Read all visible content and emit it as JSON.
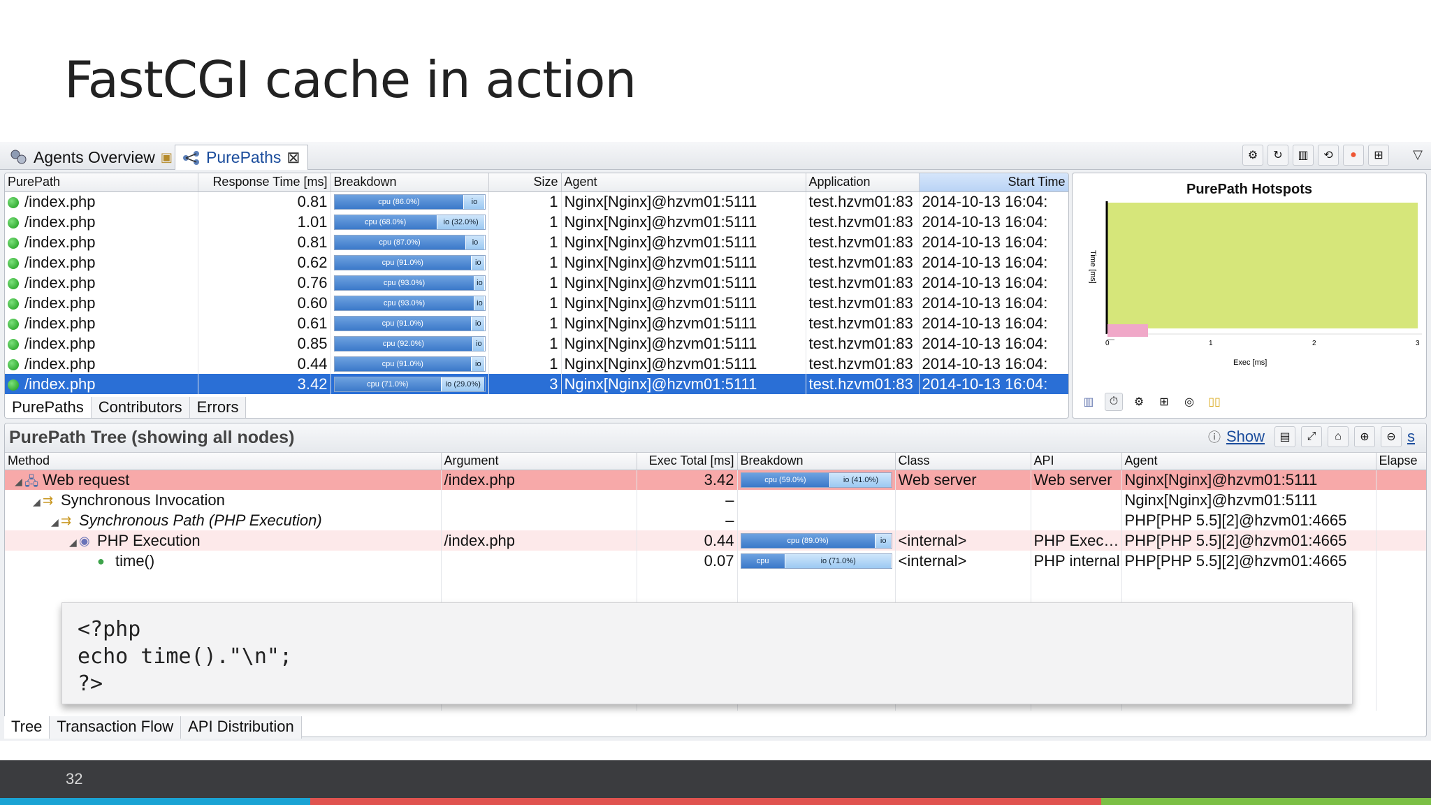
{
  "slide": {
    "title": "FastCGI cache in action",
    "page_number": "32"
  },
  "tabs": [
    {
      "label": "Agents Overview",
      "icon": "agents-icon"
    },
    {
      "label": "PurePaths",
      "icon": "purepaths-icon",
      "close": "⊠"
    }
  ],
  "purepaths": {
    "columns": [
      "PurePath",
      "Response Time [ms]",
      "Breakdown",
      "Size",
      "Agent",
      "Application",
      "Start Time"
    ],
    "rows": [
      {
        "path": "/index.php",
        "rt": "0.81",
        "cpu": "cpu (86.0%)",
        "io": "io",
        "cpu_pct": 86,
        "size": "1",
        "agent": "Nginx[Nginx]@hzvm01:5111",
        "app": "test.hzvm01:83",
        "start": "2014-10-13 16:04:"
      },
      {
        "path": "/index.php",
        "rt": "1.01",
        "cpu": "cpu (68.0%)",
        "io": "io (32.0%)",
        "cpu_pct": 68,
        "size": "1",
        "agent": "Nginx[Nginx]@hzvm01:5111",
        "app": "test.hzvm01:83",
        "start": "2014-10-13 16:04:"
      },
      {
        "path": "/index.php",
        "rt": "0.81",
        "cpu": "cpu (87.0%)",
        "io": "io",
        "cpu_pct": 87,
        "size": "1",
        "agent": "Nginx[Nginx]@hzvm01:5111",
        "app": "test.hzvm01:83",
        "start": "2014-10-13 16:04:"
      },
      {
        "path": "/index.php",
        "rt": "0.62",
        "cpu": "cpu (91.0%)",
        "io": "io",
        "cpu_pct": 91,
        "size": "1",
        "agent": "Nginx[Nginx]@hzvm01:5111",
        "app": "test.hzvm01:83",
        "start": "2014-10-13 16:04:"
      },
      {
        "path": "/index.php",
        "rt": "0.76",
        "cpu": "cpu (93.0%)",
        "io": "io",
        "cpu_pct": 93,
        "size": "1",
        "agent": "Nginx[Nginx]@hzvm01:5111",
        "app": "test.hzvm01:83",
        "start": "2014-10-13 16:04:"
      },
      {
        "path": "/index.php",
        "rt": "0.60",
        "cpu": "cpu (93.0%)",
        "io": "io",
        "cpu_pct": 93,
        "size": "1",
        "agent": "Nginx[Nginx]@hzvm01:5111",
        "app": "test.hzvm01:83",
        "start": "2014-10-13 16:04:"
      },
      {
        "path": "/index.php",
        "rt": "0.61",
        "cpu": "cpu (91.0%)",
        "io": "io",
        "cpu_pct": 91,
        "size": "1",
        "agent": "Nginx[Nginx]@hzvm01:5111",
        "app": "test.hzvm01:83",
        "start": "2014-10-13 16:04:"
      },
      {
        "path": "/index.php",
        "rt": "0.85",
        "cpu": "cpu (92.0%)",
        "io": "io",
        "cpu_pct": 92,
        "size": "1",
        "agent": "Nginx[Nginx]@hzvm01:5111",
        "app": "test.hzvm01:83",
        "start": "2014-10-13 16:04:"
      },
      {
        "path": "/index.php",
        "rt": "0.44",
        "cpu": "cpu (91.0%)",
        "io": "io",
        "cpu_pct": 91,
        "size": "1",
        "agent": "Nginx[Nginx]@hzvm01:5111",
        "app": "test.hzvm01:83",
        "start": "2014-10-13 16:04:"
      },
      {
        "path": "/index.php",
        "rt": "3.42",
        "cpu": "cpu (71.0%)",
        "io": "io (29.0%)",
        "cpu_pct": 71,
        "size": "3",
        "agent": "Nginx[Nginx]@hzvm01:5111",
        "app": "test.hzvm01:83",
        "start": "2014-10-13 16:04:",
        "selected": true
      }
    ],
    "subtabs": [
      "PurePaths",
      "Contributors",
      "Errors"
    ]
  },
  "hotspots": {
    "title": "PurePath Hotspots",
    "ylabel": "Time [ms]",
    "xlabel": "Exec [ms]",
    "x_ticks": [
      "0",
      "1",
      "2",
      "3"
    ],
    "block_color": "#d6e67a",
    "bar_color": "#f0a8c8"
  },
  "tree": {
    "title": "PurePath Tree (showing all nodes)",
    "show_link": "Show",
    "trailing_link": "s",
    "columns": [
      "Method",
      "Argument",
      "Exec Total [ms]",
      "Breakdown",
      "Class",
      "API",
      "Agent",
      "Elapse"
    ],
    "rows": [
      {
        "twisty": "◢",
        "indent": 0,
        "icon": "web-request-icon",
        "method": "Web request",
        "italic": false,
        "arg": "/index.php",
        "exec": "3.42",
        "cpu": "cpu (59.0%)",
        "io": "io (41.0%)",
        "cpu_pct": 59,
        "class": "Web server",
        "api": "Web server",
        "agent": "Nginx[Nginx]@hzvm01:5111",
        "style": "hi"
      },
      {
        "twisty": "◢",
        "indent": 1,
        "icon": "sync-invocation-icon",
        "method": "Synchronous Invocation",
        "italic": false,
        "arg": "",
        "exec": "–",
        "cpu": "",
        "io": "",
        "cpu_pct": null,
        "class": "",
        "api": "",
        "agent": "Nginx[Nginx]@hzvm01:5111",
        "style": ""
      },
      {
        "twisty": "◢",
        "indent": 2,
        "icon": "sync-path-icon",
        "method": "Synchronous Path (PHP Execution)",
        "italic": true,
        "arg": "",
        "exec": "–",
        "cpu": "",
        "io": "",
        "cpu_pct": null,
        "class": "",
        "api": "",
        "agent": "PHP[PHP 5.5][2]@hzvm01:4665",
        "style": ""
      },
      {
        "twisty": "◢",
        "indent": 3,
        "icon": "php-icon",
        "method": "PHP Execution",
        "italic": false,
        "arg": "/index.php",
        "exec": "0.44",
        "cpu": "cpu (89.0%)",
        "io": "io",
        "cpu_pct": 89,
        "class": "<internal>",
        "api": "PHP Exec…",
        "agent": "PHP[PHP 5.5][2]@hzvm01:4665",
        "style": "hl"
      },
      {
        "twisty": "",
        "indent": 4,
        "icon": "php-method-icon",
        "method": "time()",
        "italic": false,
        "arg": "",
        "exec": "0.07",
        "cpu": "cpu",
        "io": "io (71.0%)",
        "cpu_pct": 29,
        "class": "<internal>",
        "api": "PHP internal",
        "agent": "PHP[PHP 5.5][2]@hzvm01:4665",
        "style": ""
      }
    ],
    "subtabs": [
      "Tree",
      "Transaction Flow",
      "API Distribution"
    ]
  },
  "code": "<?php\necho time().\"\\n\";\n?>",
  "colors": {
    "accent_blue": "#2a6fd6",
    "footer_bg": "#3b3c3f",
    "stripe_blue": "#1aa3d4",
    "stripe_red": "#e0534f",
    "stripe_green": "#7bbf45"
  }
}
